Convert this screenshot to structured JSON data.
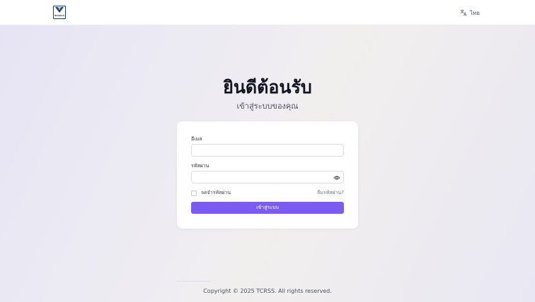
{
  "header": {
    "logo_text": "BZGNCS",
    "language_label": "ไทย"
  },
  "page": {
    "title": "ยินดีต้อนรับ",
    "subtitle": "เข้าสู่ระบบของคุณ"
  },
  "form": {
    "email_label": "อีเมล",
    "email_value": "",
    "password_label": "รหัสผ่าน",
    "password_value": "",
    "remember_label": "จดจำรหัสผ่าน",
    "remember_checked": false,
    "forgot_label": "ลืมรหัสผ่าน?",
    "submit_label": "เข้าสู่ระบบ"
  },
  "footer": {
    "copyright": "Copyright © 2025 TCRSS. All rights reserved."
  },
  "colors": {
    "primary": "#7c5cf0",
    "logo_blue": "#1d3f73"
  },
  "icons": {
    "language": "translate-icon",
    "password_toggle": "eye-icon"
  }
}
